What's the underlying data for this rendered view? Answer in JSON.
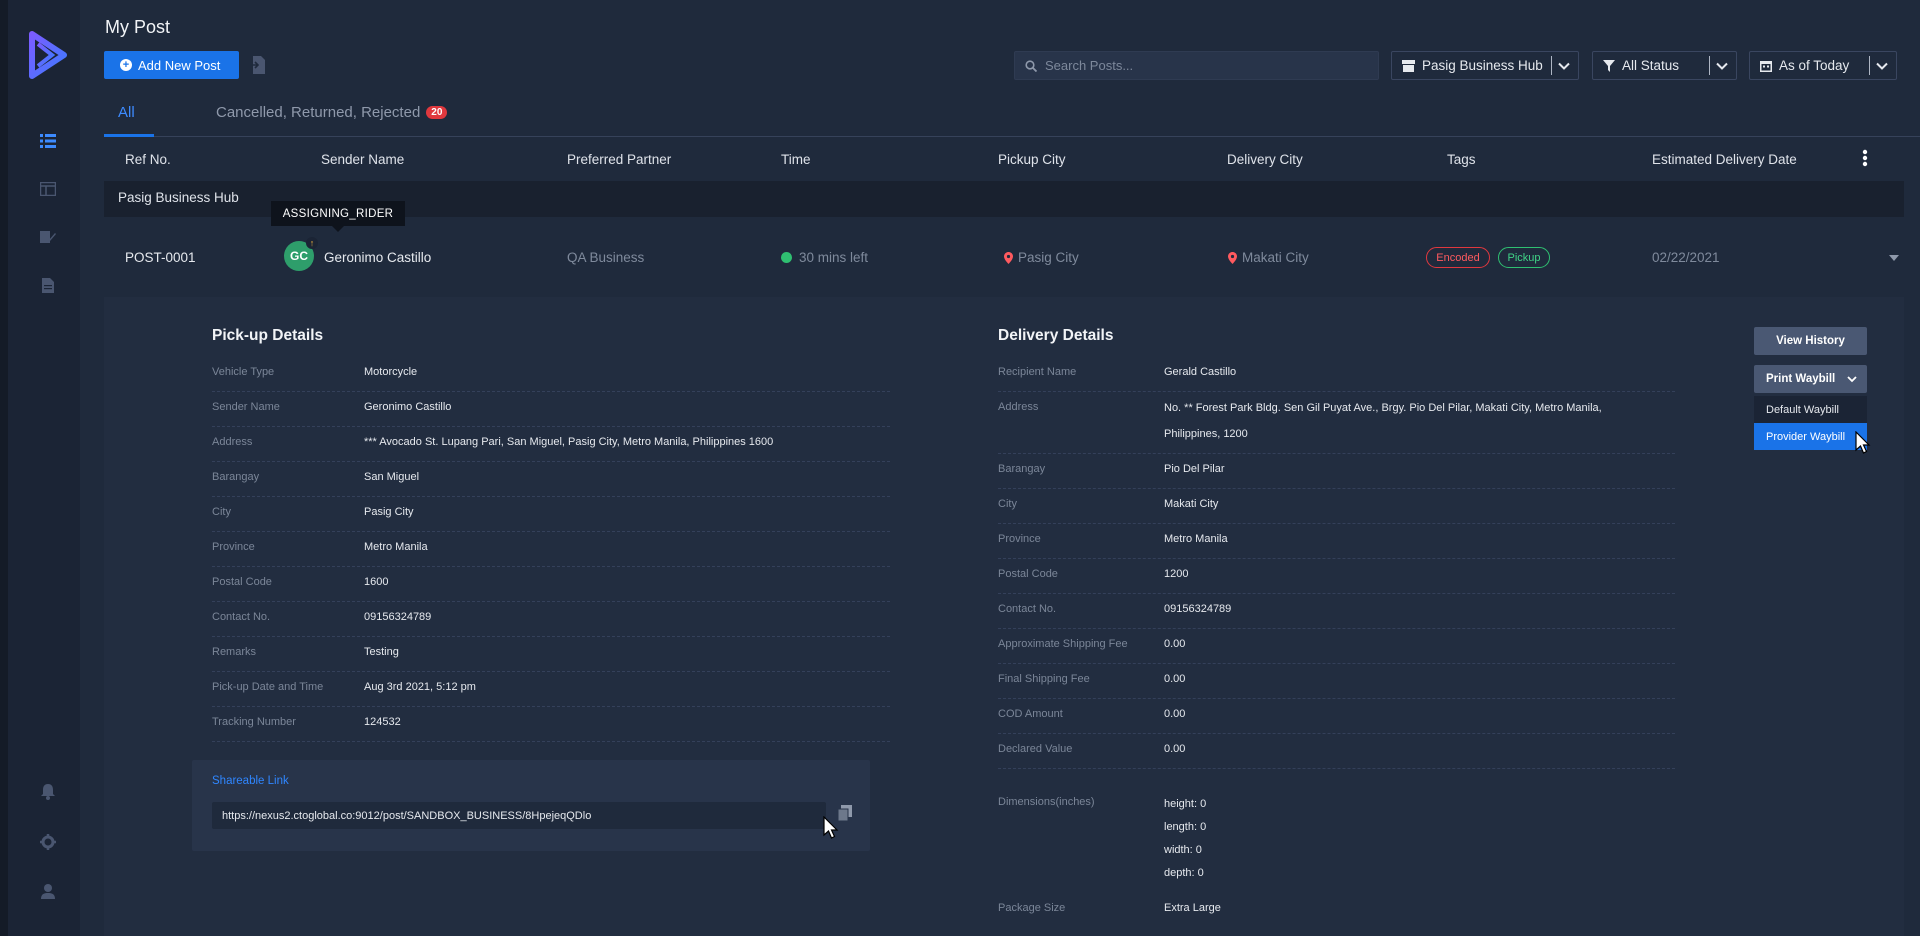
{
  "page": {
    "title": "My Post"
  },
  "toolbar": {
    "add_label": "Add New Post",
    "search_placeholder": "Search Posts...",
    "hub_select": "Pasig Business Hub",
    "status_select": "All Status",
    "date_select": "As of Today"
  },
  "tabs": [
    {
      "label": "All"
    },
    {
      "label": "Cancelled, Returned, Rejected",
      "count": "20"
    }
  ],
  "columns": [
    "Ref No.",
    "Sender Name",
    "Preferred Partner",
    "Time",
    "Pickup City",
    "Delivery City",
    "Tags",
    "Estimated Delivery Date"
  ],
  "group": {
    "label": "Pasig Business Hub"
  },
  "tooltip": "ASSIGNING_RIDER",
  "post": {
    "ref": "POST-0001",
    "avatar_initials": "GC",
    "sender": "Geronimo Castillo",
    "partner": "QA Business",
    "time": "30 mins left",
    "pickup_city": "Pasig City",
    "delivery_city": "Makati City",
    "tags": [
      "Encoded",
      "Pickup"
    ],
    "est_date": "02/22/2021"
  },
  "pickup": {
    "title": "Pick-up Details",
    "fields": [
      {
        "k": "Vehicle Type",
        "v": "Motorcycle"
      },
      {
        "k": "Sender Name",
        "v": "Geronimo Castillo"
      },
      {
        "k": "Address",
        "v": "*** Avocado St. Lupang Pari, San Miguel, Pasig City,  Metro Manila, Philippines 1600"
      },
      {
        "k": "Barangay",
        "v": "San Miguel"
      },
      {
        "k": "City",
        "v": "Pasig City"
      },
      {
        "k": "Province",
        "v": "Metro Manila"
      },
      {
        "k": "Postal Code",
        "v": "1600"
      },
      {
        "k": "Contact No.",
        "v": "09156324789"
      },
      {
        "k": "Remarks",
        "v": "Testing"
      },
      {
        "k": "Pick-up Date and Time",
        "v": "Aug 3rd 2021, 5:12 pm"
      },
      {
        "k": "Tracking Number",
        "v": "124532"
      }
    ],
    "share_title": "Shareable Link",
    "share_url": "https://nexus2.ctoglobal.co:9012/post/SANDBOX_BUSINESS/8HpejeqQDlo"
  },
  "delivery": {
    "title": "Delivery Details",
    "recipient": {
      "k": "Recipient Name",
      "v": "Gerald Castillo"
    },
    "address": {
      "k": "Address",
      "v1": "No. ** Forest Park Bldg. Sen Gil Puyat Ave., Brgy. Pio Del Pilar, Makati City, Metro Manila,",
      "v2": "Philippines, 1200"
    },
    "fields": [
      {
        "k": "Barangay",
        "v": "Pio Del Pilar"
      },
      {
        "k": "City",
        "v": "Makati City"
      },
      {
        "k": "Province",
        "v": "Metro Manila"
      },
      {
        "k": "Postal Code",
        "v": "1200"
      },
      {
        "k": "Contact No.",
        "v": "09156324789"
      },
      {
        "k": "Approximate Shipping Fee",
        "v": "0.00"
      },
      {
        "k": "Final Shipping Fee",
        "v": "0.00"
      },
      {
        "k": "COD Amount",
        "v": "0.00"
      },
      {
        "k": "Declared Value",
        "v": "0.00"
      }
    ],
    "dimensions": {
      "k": "Dimensions(inches)",
      "height": "height:  0",
      "length": "length:  0",
      "width": "width:  0",
      "depth": "depth:  0"
    },
    "package": {
      "k": "Package Size",
      "v": "Extra Large"
    }
  },
  "actions": {
    "history": "View History",
    "print": "Print Waybill",
    "menu": [
      "Default Waybill",
      "Provider Waybill"
    ]
  },
  "colors": {
    "accent": "#1a73e8",
    "danger": "#e0383e",
    "success": "#2fbf71",
    "background": "#1f2a3c"
  }
}
